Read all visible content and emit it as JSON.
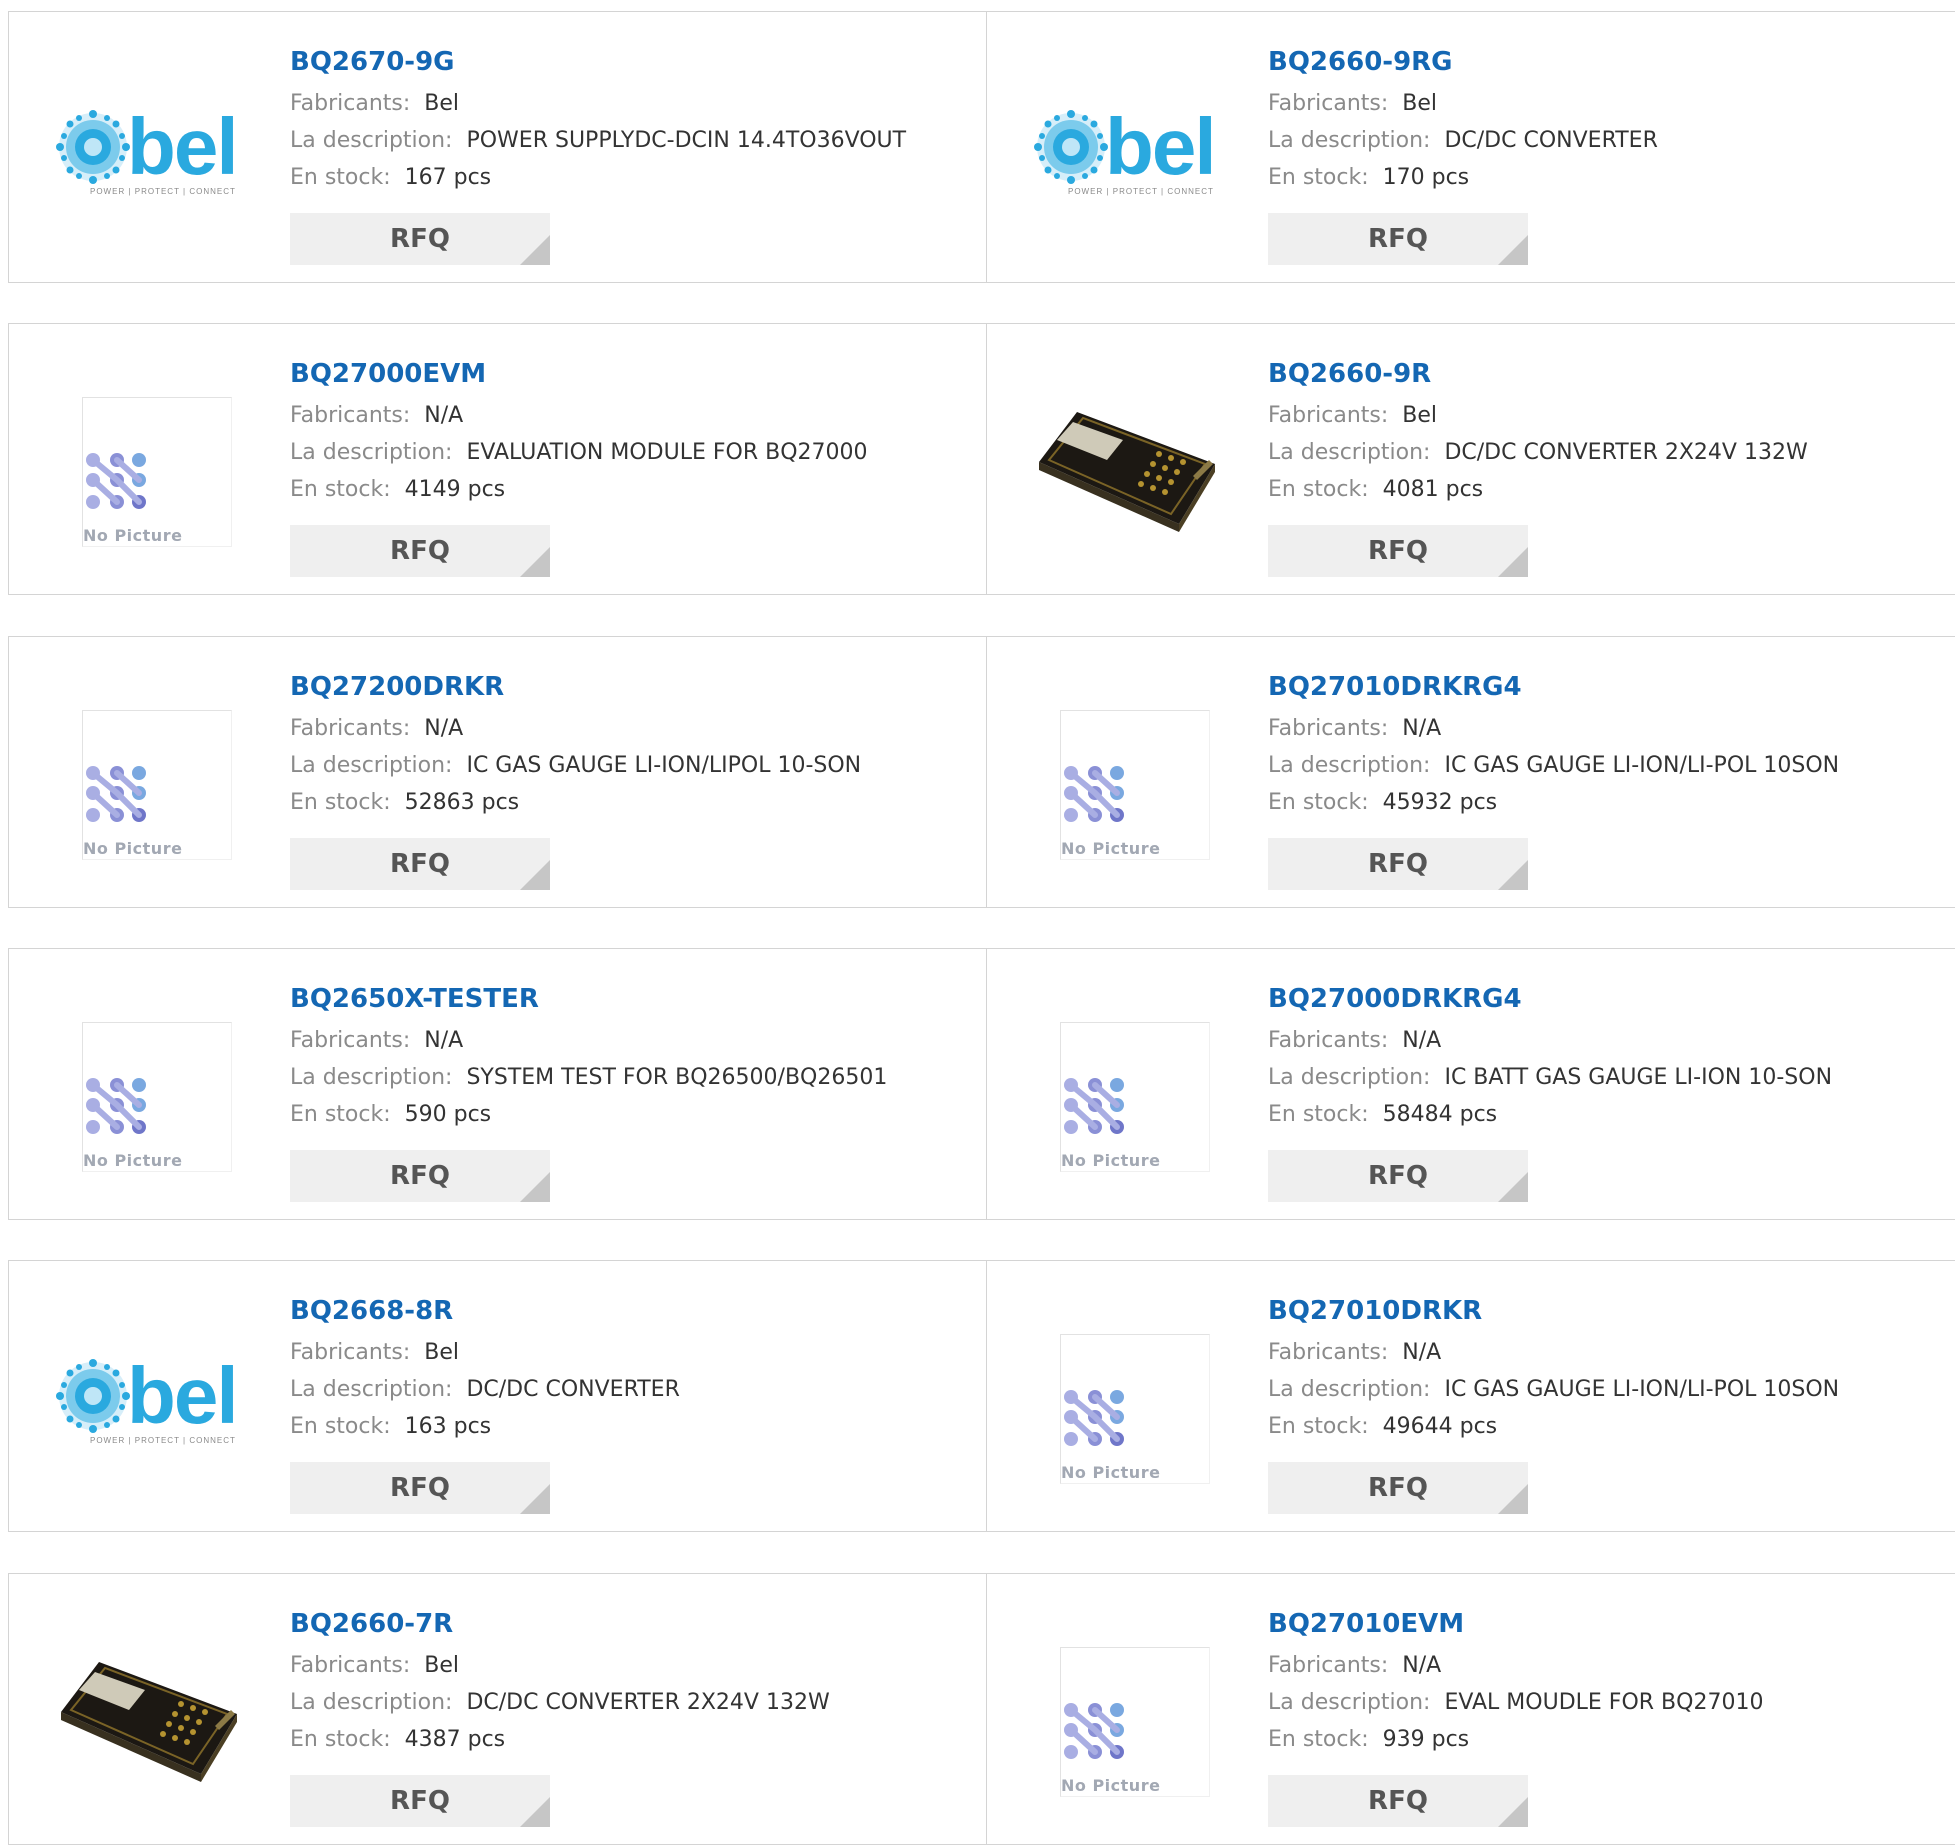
{
  "labels": {
    "manufacturer": "Fabricants:",
    "description": "La description:",
    "stock": "En stock:",
    "rfq": "RFQ",
    "no_picture": "No Picture",
    "bel_tagline": "POWER | PROTECT | CONNECT",
    "bel_wordmark": "bel"
  },
  "products": [
    {
      "part": "BQ2670-9G",
      "manufacturer": "Bel",
      "description": "POWER SUPPLYDC-DCIN 14.4TO36VOUT",
      "stock": "167 pcs",
      "image": "bel-logo"
    },
    {
      "part": "BQ2660-9RG",
      "manufacturer": "Bel",
      "description": "DC/DC CONVERTER",
      "stock": "170 pcs",
      "image": "bel-logo"
    },
    {
      "part": "BQ27000EVM",
      "manufacturer": "N/A",
      "description": "EVALUATION MODULE FOR BQ27000",
      "stock": "4149 pcs",
      "image": "no-picture"
    },
    {
      "part": "BQ2660-9R",
      "manufacturer": "Bel",
      "description": "DC/DC CONVERTER 2X24V 132W",
      "stock": "4081 pcs",
      "image": "module-photo"
    },
    {
      "part": "BQ27200DRKR",
      "manufacturer": "N/A",
      "description": "IC GAS GAUGE LI-ION/LIPOL 10-SON",
      "stock": "52863 pcs",
      "image": "no-picture"
    },
    {
      "part": "BQ27010DRKRG4",
      "manufacturer": "N/A",
      "description": "IC GAS GAUGE LI-ION/LI-POL 10SON",
      "stock": "45932 pcs",
      "image": "no-picture"
    },
    {
      "part": "BQ2650X-TESTER",
      "manufacturer": "N/A",
      "description": "SYSTEM TEST FOR BQ26500/BQ26501",
      "stock": "590 pcs",
      "image": "no-picture"
    },
    {
      "part": "BQ27000DRKRG4",
      "manufacturer": "N/A",
      "description": "IC BATT GAS GAUGE LI-ION 10-SON",
      "stock": "58484 pcs",
      "image": "no-picture"
    },
    {
      "part": "BQ2668-8R",
      "manufacturer": "Bel",
      "description": "DC/DC CONVERTER",
      "stock": "163 pcs",
      "image": "bel-logo"
    },
    {
      "part": "BQ27010DRKR",
      "manufacturer": "N/A",
      "description": "IC GAS GAUGE LI-ION/LI-POL 10SON",
      "stock": "49644 pcs",
      "image": "no-picture"
    },
    {
      "part": "BQ2660-7R",
      "manufacturer": "Bel",
      "description": "DC/DC CONVERTER 2X24V 132W",
      "stock": "4387 pcs",
      "image": "module-photo"
    },
    {
      "part": "BQ27010EVM",
      "manufacturer": "N/A",
      "description": "EVAL MOUDLE FOR BQ27010",
      "stock": "939 pcs",
      "image": "no-picture"
    }
  ],
  "colors": {
    "link": "#1467b3",
    "label": "#8a8a8a",
    "value": "#333333",
    "rfq_bg": "#efefef",
    "border": "#d4d4d4",
    "bel_blue": "#2aa9df"
  }
}
